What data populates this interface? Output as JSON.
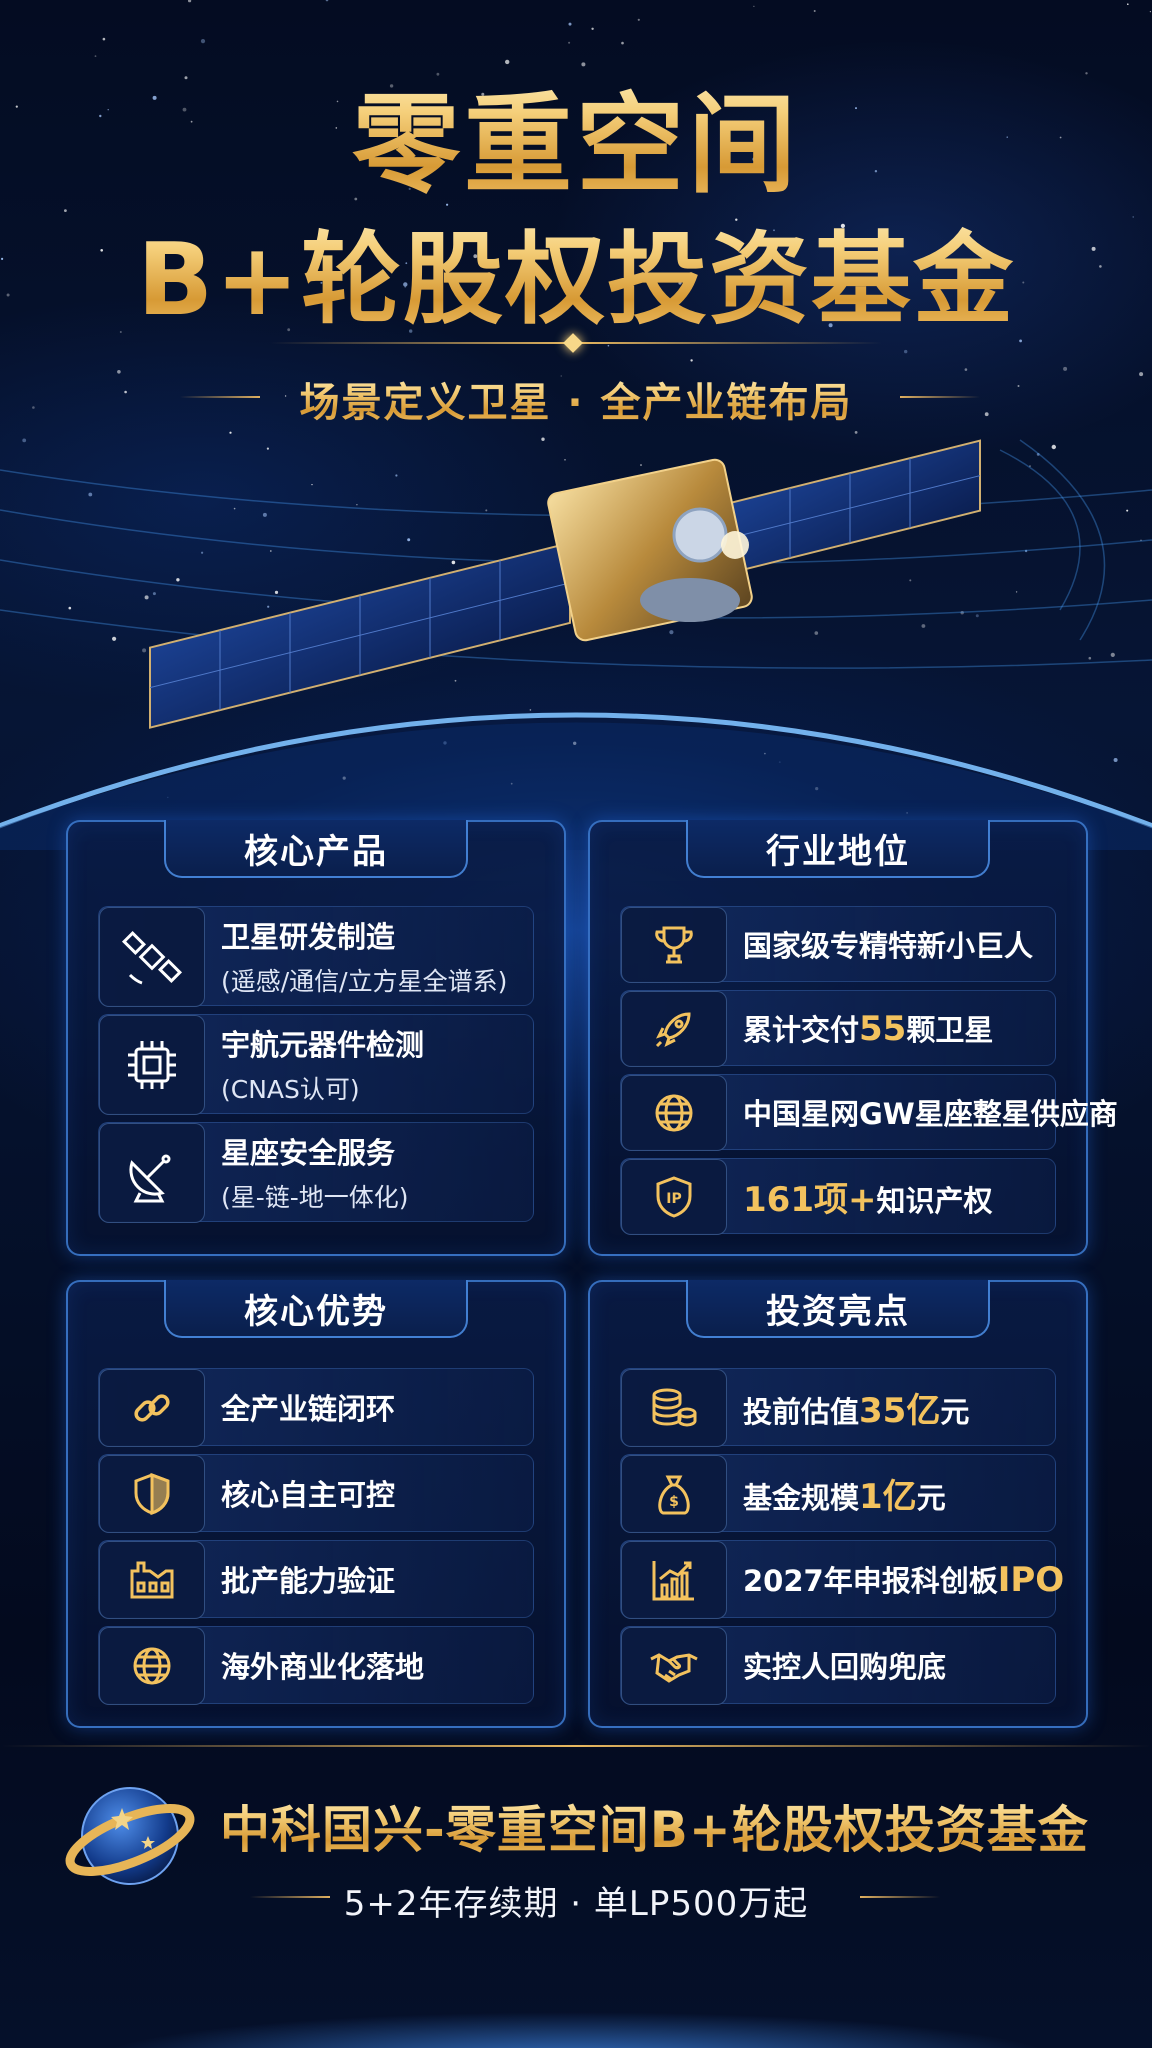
{
  "header": {
    "title_line1": "零重空间",
    "title_line2": "B+轮股权投资基金",
    "subtitle": "场景定义卫星 · 全产业链布局"
  },
  "hero": {
    "image": "satellite-over-earth"
  },
  "panels": {
    "core_products": {
      "title": "核心产品",
      "items": [
        {
          "icon": "satellite-icon",
          "main": "卫星研发制造",
          "sub": "(遥感/通信/立方星全谱系)"
        },
        {
          "icon": "chip-icon",
          "main": "宇航元器件检测",
          "sub": "(CNAS认可)"
        },
        {
          "icon": "satellite-dish-icon",
          "main": "星座安全服务",
          "sub": "(星-链-地一体化)"
        }
      ]
    },
    "industry_position": {
      "title": "行业地位",
      "items": [
        {
          "icon": "trophy-icon",
          "text": "国家级专精特新小巨人"
        },
        {
          "icon": "rocket-icon",
          "pre": "累计交付",
          "hl": "55",
          "post": "颗卫星"
        },
        {
          "icon": "globe-icon",
          "text": "中国星网GW星座整星供应商"
        },
        {
          "icon": "ip-shield-icon",
          "hl": "161项+",
          "post": "知识产权"
        }
      ]
    },
    "core_advantages": {
      "title": "核心优势",
      "items": [
        {
          "icon": "chain-link-icon",
          "text": "全产业链闭环"
        },
        {
          "icon": "shield-icon",
          "text": "核心自主可控"
        },
        {
          "icon": "factory-icon",
          "text": "批产能力验证"
        },
        {
          "icon": "globe-icon",
          "text": "海外商业化落地"
        }
      ]
    },
    "investment_highlights": {
      "title": "投资亮点",
      "items": [
        {
          "icon": "coins-icon",
          "pre": "投前估值",
          "hl": "35亿",
          "post": "元"
        },
        {
          "icon": "money-bag-icon",
          "pre": "基金规模",
          "hl": "1亿",
          "post": "元"
        },
        {
          "icon": "growth-chart-icon",
          "pre": "2027年申报科创板",
          "hl": "IPO",
          "post": ""
        },
        {
          "icon": "handshake-icon",
          "text": "实控人回购兜底"
        }
      ]
    }
  },
  "footer": {
    "logo": "planet-ring-logo",
    "title": "中科国兴-零重空间B+轮股权投资基金",
    "subtitle": "5+2年存续期  ·  单LP500万起"
  },
  "colors": {
    "gold": "#f3c25e",
    "panel_border": "#468ceb",
    "background": "#030a1c"
  }
}
